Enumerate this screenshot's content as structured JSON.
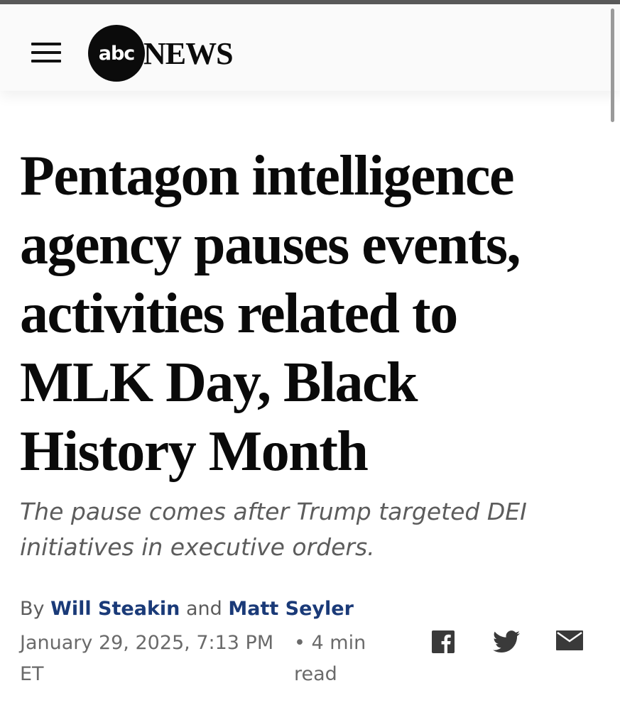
{
  "header": {
    "logo_mark": "abc",
    "logo_text": "NEWS"
  },
  "article": {
    "headline": "Pentagon intelligence agency pauses events, activities related to MLK Day, Black History Month",
    "subheadline": "The pause comes after Trump targeted DEI initiatives in executive orders.",
    "byline": {
      "prefix": "By",
      "author1": "Will Steakin",
      "conjunction": "and",
      "author2": "Matt Seyler"
    },
    "date": "January 29, 2025, 7:13 PM ET",
    "read_time": "• 4 min read"
  },
  "share": {
    "icons": [
      "facebook-icon",
      "twitter-icon",
      "email-icon"
    ]
  },
  "colors": {
    "author_link": "#1a3a78",
    "secondary_text": "#5c5c5c",
    "logo": "#0b0b0b"
  }
}
